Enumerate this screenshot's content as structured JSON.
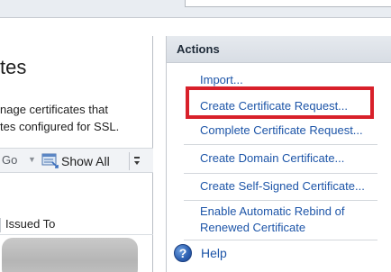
{
  "left_pane": {
    "title_fragment": "tes",
    "description_lines": [
      "nage certificates that",
      "tes configured for SSL."
    ],
    "toolbar": {
      "go_label": "Go",
      "go_arrow_icon": "dropdown-arrow-icon",
      "show_all_label": "Show All",
      "show_all_icon": "show-all-icon"
    },
    "table": {
      "columns": [
        "Issued To"
      ],
      "rows": [
        "(redacted)"
      ]
    }
  },
  "actions_pane": {
    "header": "Actions",
    "items": [
      {
        "label": "Import..."
      },
      {
        "label": "Create Certificate Request..."
      },
      {
        "label": "Complete Certificate Request..."
      },
      {
        "label": "Create Domain Certificate..."
      },
      {
        "label": "Create Self-Signed Certificate..."
      },
      {
        "label": "Enable Automatic Rebind of"
      },
      {
        "label": "Renewed Certificate"
      }
    ],
    "help": {
      "label": "Help",
      "icon": "help-icon"
    }
  },
  "colors": {
    "link": "#1d55a8",
    "highlight": "#d8202a",
    "header_bg": "#dde2e8"
  }
}
